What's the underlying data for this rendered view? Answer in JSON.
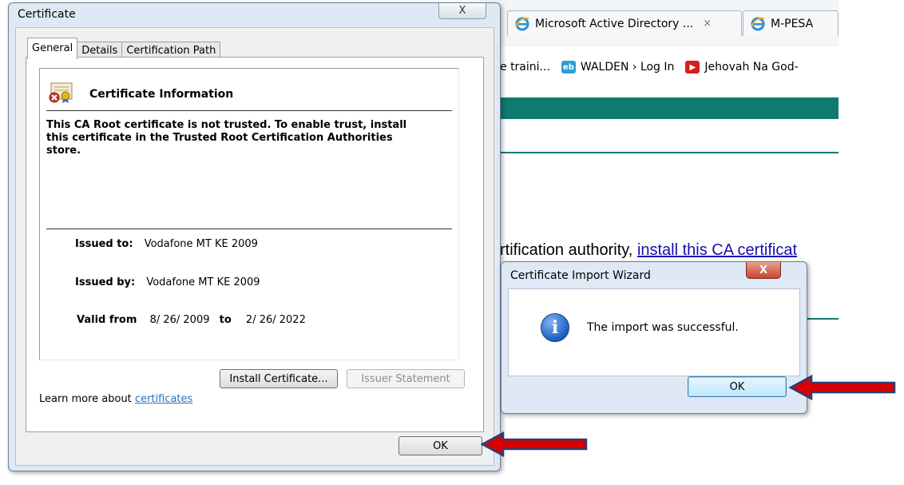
{
  "browser": {
    "tabs": [
      {
        "label": "Microsoft Active Directory ...",
        "close": "×"
      },
      {
        "label": "M-PESA"
      }
    ],
    "bookmarks": [
      {
        "label": "e traini..."
      },
      {
        "label": "WALDEN › Log In"
      },
      {
        "label": "Jehovah Na God-"
      }
    ],
    "page": {
      "text": "rtification authority, ",
      "link": "install this CA certificat"
    }
  },
  "cert_dialog": {
    "title": "Certificate",
    "close_glyph": "X",
    "tabs": [
      "General",
      "Details",
      "Certification Path"
    ],
    "info_title": "Certificate Information",
    "info_message": "This CA Root certificate is not trusted. To enable trust, install this certificate in the Trusted Root Certification Authorities store.",
    "issued_to_label": "Issued to:",
    "issued_to_value": "Vodafone MT KE 2009",
    "issued_by_label": "Issued by:",
    "issued_by_value": "Vodafone MT KE 2009",
    "valid_from_label": "Valid from",
    "valid_from_value": "8/ 26/ 2009",
    "valid_to_label": "to",
    "valid_to_value": "2/ 26/ 2022",
    "install_button": "Install Certificate...",
    "issuer_button": "Issuer Statement",
    "learn_more_text": "Learn more about ",
    "learn_more_link": "certificates",
    "ok_button": "OK"
  },
  "wizard": {
    "title": "Certificate Import Wizard",
    "close_glyph": "X",
    "info_glyph": "i",
    "message": "The import was successful.",
    "ok_button": "OK"
  },
  "colors": {
    "teal": "#0f7b70",
    "arrow_red": "#d90000",
    "arrow_border": "#2b3d73",
    "link_blue": "#1a0dab"
  }
}
